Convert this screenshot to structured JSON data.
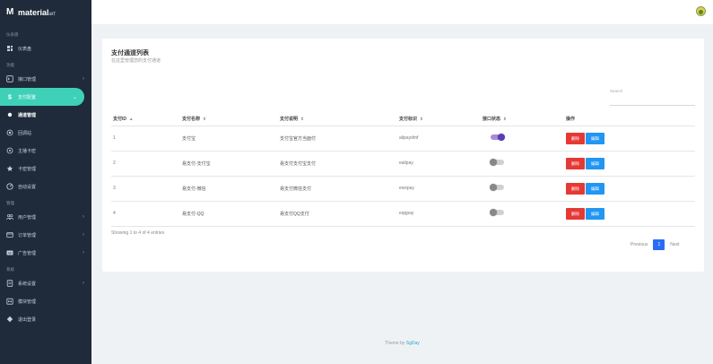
{
  "brand": {
    "name": "material",
    "suffix": "art"
  },
  "sidebar": {
    "sections": [
      {
        "title": "仪表盘",
        "items": [
          {
            "label": "仪表盘",
            "icon": "dashboard-icon"
          }
        ]
      },
      {
        "title": "功能",
        "items": [
          {
            "label": "接口管理",
            "icon": "terminal-icon",
            "chevron": "›"
          },
          {
            "label": "支付配置",
            "icon": "dollar-icon",
            "chevron": "⌄",
            "active": true
          },
          {
            "label": "通道管理",
            "icon": "dot-icon",
            "sub": true,
            "current": true
          },
          {
            "label": "回调站",
            "icon": "eye-icon",
            "sub": true
          },
          {
            "label": "主播卡密",
            "icon": "target-icon",
            "sub": true
          },
          {
            "label": "卡密管理",
            "icon": "star-icon",
            "sub": true
          },
          {
            "label": "自动设置",
            "icon": "gauge-icon"
          }
        ]
      },
      {
        "title": "管理",
        "items": [
          {
            "label": "用户管理",
            "icon": "users-icon",
            "chevron": "›"
          },
          {
            "label": "订单管理",
            "icon": "card-icon",
            "chevron": "›"
          },
          {
            "label": "广告管理",
            "icon": "ad-icon",
            "chevron": "›"
          }
        ]
      },
      {
        "title": "系统",
        "items": [
          {
            "label": "系统设置",
            "icon": "doc-icon",
            "chevron": "›"
          },
          {
            "label": "模块管理",
            "icon": "calendar-icon"
          },
          {
            "label": "退出登录",
            "icon": "logout-icon"
          }
        ]
      }
    ]
  },
  "card": {
    "title": "支付通道列表",
    "subtitle": "在这里管理您的支付通道",
    "search_placeholder": "Search",
    "columns": [
      "支付ID",
      "支付名称",
      "支付说明",
      "支付标识",
      "接口状态",
      "操作"
    ],
    "sort_marks": [
      "▲",
      "⇕",
      "⇕",
      "⇕",
      "⇕",
      ""
    ],
    "rows": [
      {
        "id": "1",
        "name": "支付宝",
        "desc": "支付宝官方当面付",
        "key": "alipaydmf",
        "enabled": true
      },
      {
        "id": "2",
        "name": "易支付-支付宝",
        "desc": "易支付支付宝支付",
        "key": "ealipay",
        "enabled": false
      },
      {
        "id": "3",
        "name": "易支付-微信",
        "desc": "易支付微信支付",
        "key": "ewxpay",
        "enabled": false
      },
      {
        "id": "4",
        "name": "易支付-QQ",
        "desc": "易支付QQ支付",
        "key": "eqqpay",
        "enabled": false
      }
    ],
    "btn_delete": "删除",
    "btn_edit": "编辑",
    "info": "Showing 1 to 4 of 4 entries",
    "pager": {
      "prev": "Previous",
      "current": "1",
      "next": "Next"
    }
  },
  "footer": {
    "prefix": "Theme by ",
    "link": "SgDay"
  }
}
